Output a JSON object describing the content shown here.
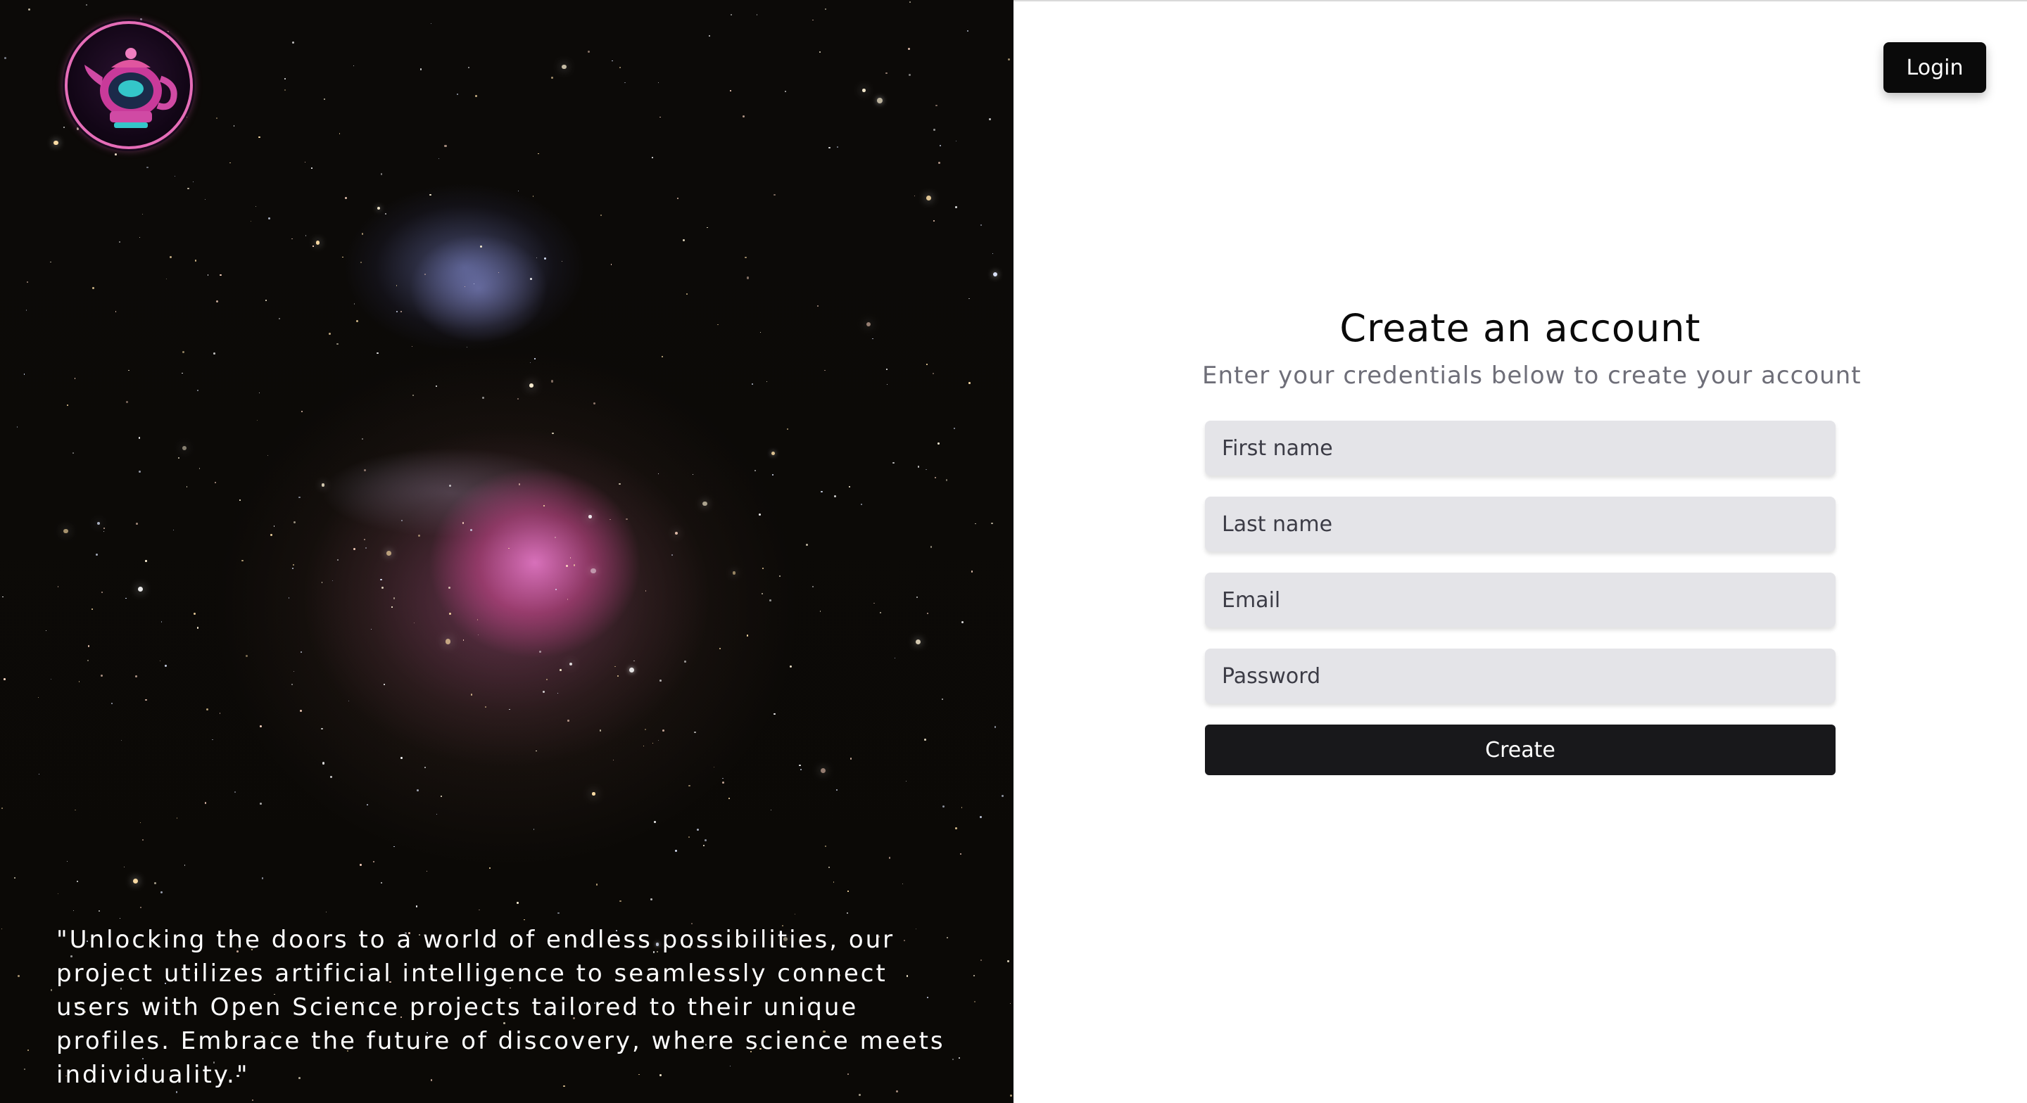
{
  "hero": {
    "logo_name": "teapot-418-logo",
    "quote": "\"Unlocking the doors to a world of endless possibilities, our project utilizes artificial intelligence to seamlessly connect users with Open Science projects tailored to their unique profiles. Embrace the future of discovery, where science meets individuality.\""
  },
  "header": {
    "login_label": "Login"
  },
  "form": {
    "title": "Create an account",
    "subtitle": "Enter your credentials below to create your account",
    "first_name_placeholder": "First name",
    "last_name_placeholder": "Last name",
    "email_placeholder": "Email",
    "password_placeholder": "Password",
    "submit_label": "Create"
  },
  "colors": {
    "primary_button": "#18181b",
    "input_background": "#e4e4e8",
    "logo_accent": "#e56db8"
  }
}
